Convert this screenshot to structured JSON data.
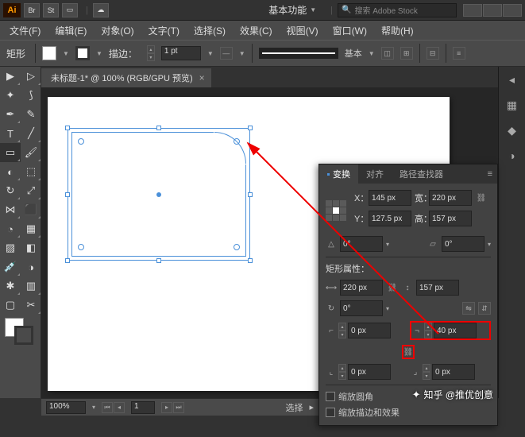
{
  "app": {
    "logo": "Ai"
  },
  "title_icons": [
    "Br",
    "St"
  ],
  "workspace": "基本功能",
  "search": {
    "placeholder": "搜索 Adobe Stock"
  },
  "menu": [
    "文件(F)",
    "编辑(E)",
    "对象(O)",
    "文字(T)",
    "选择(S)",
    "效果(C)",
    "视图(V)",
    "窗口(W)",
    "帮助(H)"
  ],
  "control": {
    "shape_label": "矩形",
    "stroke_label": "描边：",
    "stroke_weight": "1 pt",
    "style_label": "基本"
  },
  "doc": {
    "tab_title": "未标题-1* @ 100% (RGB/GPU 预览)"
  },
  "transform": {
    "tabs": [
      "变换",
      "对齐",
      "路径查找器"
    ],
    "x_label": "X：",
    "x": "145 px",
    "y_label": "Y：",
    "y": "127.5 px",
    "w_label": "宽：",
    "w": "220 px",
    "h_label": "高：",
    "h": "157 px",
    "angle": "0°",
    "shear": "0°",
    "section": "矩形属性：",
    "rect_w": "220 px",
    "rect_h": "157 px",
    "rect_angle": "0°",
    "corners": {
      "tl": "0 px",
      "tr": "40 px",
      "bl": "0 px",
      "br": "0 px"
    },
    "check1": "缩放圆角",
    "check2": "缩放描边和效果"
  },
  "status": {
    "zoom": "100%",
    "page": "1",
    "mode": "选择"
  },
  "watermark": "知乎 @推优创意"
}
